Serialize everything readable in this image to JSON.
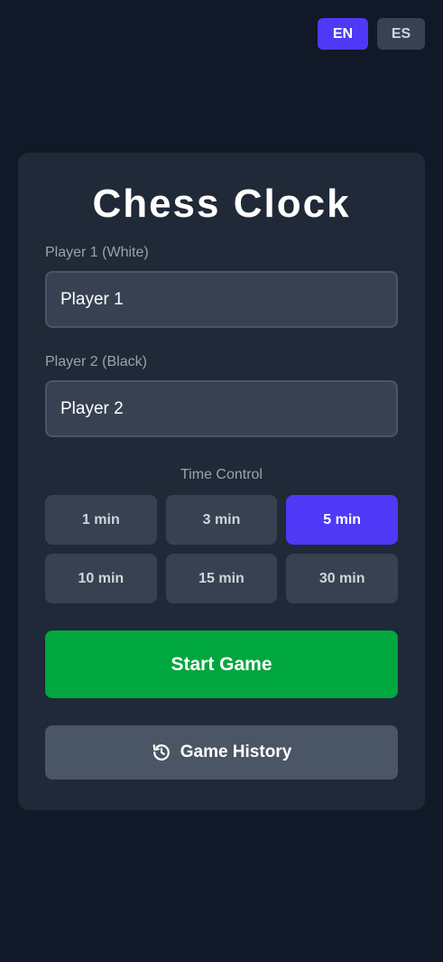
{
  "language": {
    "options": [
      "EN",
      "ES"
    ],
    "selected": "EN"
  },
  "app": {
    "title": "Chess Clock"
  },
  "players": {
    "player1": {
      "label": "Player 1 (White)",
      "value": "Player 1"
    },
    "player2": {
      "label": "Player 2 (Black)",
      "value": "Player 2"
    }
  },
  "time_control": {
    "label": "Time Control",
    "options": [
      "1 min",
      "3 min",
      "5 min",
      "10 min",
      "15 min",
      "30 min"
    ],
    "selected": "5 min"
  },
  "actions": {
    "start_label": "Start Game",
    "history_label": "Game History",
    "history_icon": "history-icon"
  },
  "colors": {
    "background": "#111827",
    "card": "#1f2937",
    "accent": "#4f39f6",
    "start": "#00a63e",
    "secondary": "#4a5565"
  }
}
